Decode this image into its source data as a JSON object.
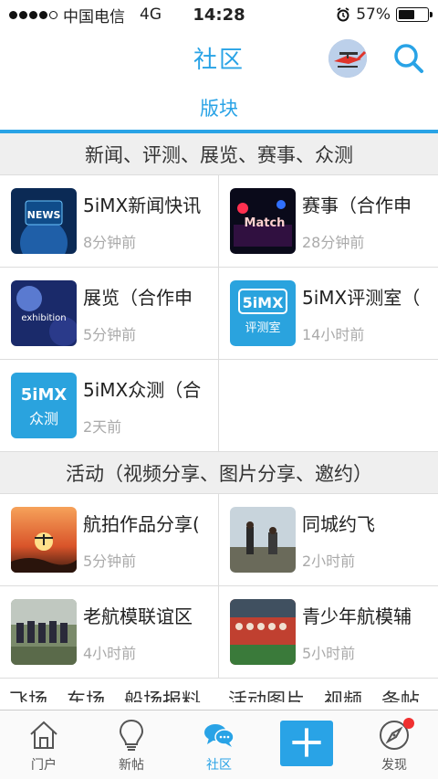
{
  "status_bar": {
    "carrier": "中国电信",
    "network": "4G",
    "time": "14:28",
    "battery": "57%",
    "battery_level": 0.57
  },
  "header": {
    "title": "社区",
    "search_icon": "search-icon"
  },
  "subtabs": [
    {
      "label": "版块"
    }
  ],
  "sections": [
    {
      "title": "新闻、评测、展览、赛事、众测",
      "items": [
        {
          "name": "5iMX新闻快讯",
          "time": "8分钟前",
          "thumb_text": "NEWS"
        },
        {
          "name": "赛事（合作申",
          "time": "28分钟前",
          "thumb_text": "Match"
        },
        {
          "name": "展览（合作申",
          "time": "5分钟前",
          "thumb_text": "exhibition"
        },
        {
          "name": "5iMX评测室（",
          "time": "14小时前",
          "thumb_text": "5iMX评测室"
        },
        {
          "name": "5iMX众测（合",
          "time": "2天前",
          "thumb_text": "5iMX众测"
        }
      ]
    },
    {
      "title": "活动（视频分享、图片分享、邀约）",
      "items": [
        {
          "name": "航拍作品分享(",
          "time": "5分钟前"
        },
        {
          "name": "同城约飞",
          "time": "2小时前"
        },
        {
          "name": "老航模联谊区",
          "time": "4小时前"
        },
        {
          "name": "青少年航模辅",
          "time": "5小时前"
        }
      ]
    }
  ],
  "partial_row": [
    "飞场、车场、船场报料",
    "活动图片、视频、条帖"
  ],
  "tabbar": [
    {
      "label": "门户",
      "icon": "house-icon"
    },
    {
      "label": "新帖",
      "icon": "lightbulb-icon"
    },
    {
      "label": "社区",
      "icon": "chat-bubbles-icon",
      "active": true
    },
    {
      "label": "",
      "icon": "plus-icon"
    },
    {
      "label": "发现",
      "icon": "compass-icon",
      "badge": true
    }
  ],
  "colors": {
    "accent": "#29a3e6",
    "badge": "#f03030"
  }
}
